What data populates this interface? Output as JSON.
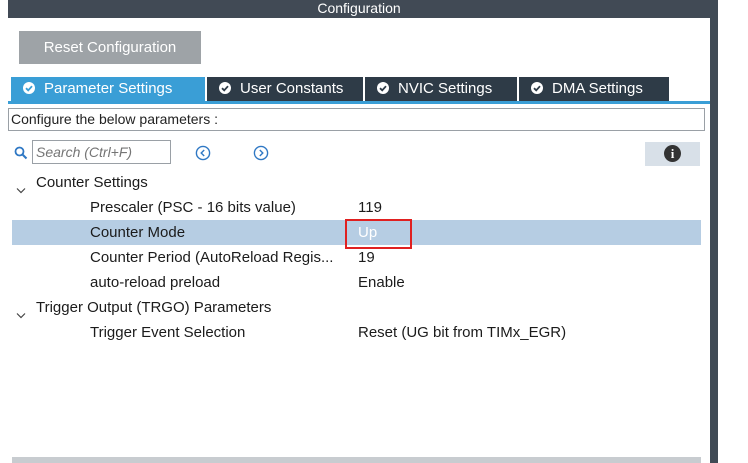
{
  "window": {
    "title": "Configuration"
  },
  "toolbar": {
    "reset_label": "Reset Configuration"
  },
  "tabs": [
    {
      "label": "Parameter Settings",
      "active": true
    },
    {
      "label": "User Constants",
      "active": false
    },
    {
      "label": "NVIC Settings",
      "active": false
    },
    {
      "label": "DMA Settings",
      "active": false
    }
  ],
  "description": "Configure the below parameters :",
  "search": {
    "placeholder": "Search (Ctrl+F)"
  },
  "icons": {
    "search": "search-icon",
    "prev": "chevron-left-circle-icon",
    "next": "chevron-right-circle-icon",
    "info": "info-icon",
    "collapse": "chevron-down-icon",
    "tab_check": "check-circle-icon"
  },
  "info_glyph": "i",
  "groups": [
    {
      "label": "Counter Settings",
      "params": [
        {
          "label": "Prescaler (PSC - 16 bits value)",
          "value": "119",
          "selected": false
        },
        {
          "label": "Counter Mode",
          "value": "Up",
          "selected": true
        },
        {
          "label": "Counter Period (AutoReload Regis...",
          "value": "19",
          "selected": false
        },
        {
          "label": "auto-reload preload",
          "value": "Enable",
          "selected": false
        }
      ]
    },
    {
      "label": "Trigger Output (TRGO) Parameters",
      "params": [
        {
          "label": "Trigger Event Selection",
          "value": "Reset (UG bit from TIMx_EGR)",
          "selected": false
        }
      ]
    }
  ],
  "colors": {
    "title_bar": "#414a55",
    "active_tab": "#3a9ed6",
    "inactive_tab": "#2e3b47",
    "selected_row": "#b6cde3",
    "highlight_box": "#e02020"
  }
}
